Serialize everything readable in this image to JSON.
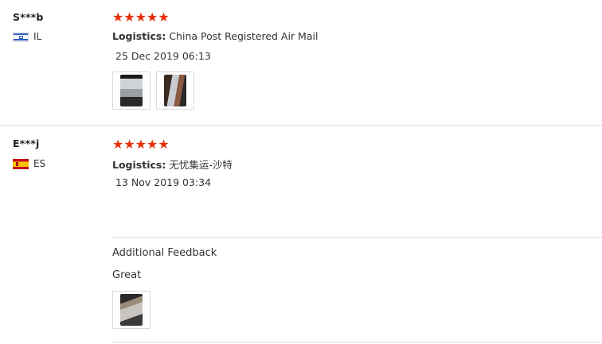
{
  "reviews": [
    {
      "buyer": "S***b",
      "country": "IL",
      "rating": "★★★★★",
      "logistics_label": "Logistics:",
      "logistics_value": "China Post Registered Air Mail",
      "date": "25 Dec 2019 06:13",
      "stars_value": 5
    },
    {
      "buyer": "E***j",
      "country": "ES",
      "rating": "★★★★★",
      "logistics_label": "Logistics:",
      "logistics_value": "无忧集运-沙特",
      "date": "13 Nov 2019 03:34",
      "stars_value": 5,
      "additional_feedback_title": "Additional Feedback",
      "additional_feedback_text": "Great"
    }
  ],
  "colors": {
    "star": "#e62e04",
    "divider": "#d9d9d9",
    "text": "#333333"
  }
}
